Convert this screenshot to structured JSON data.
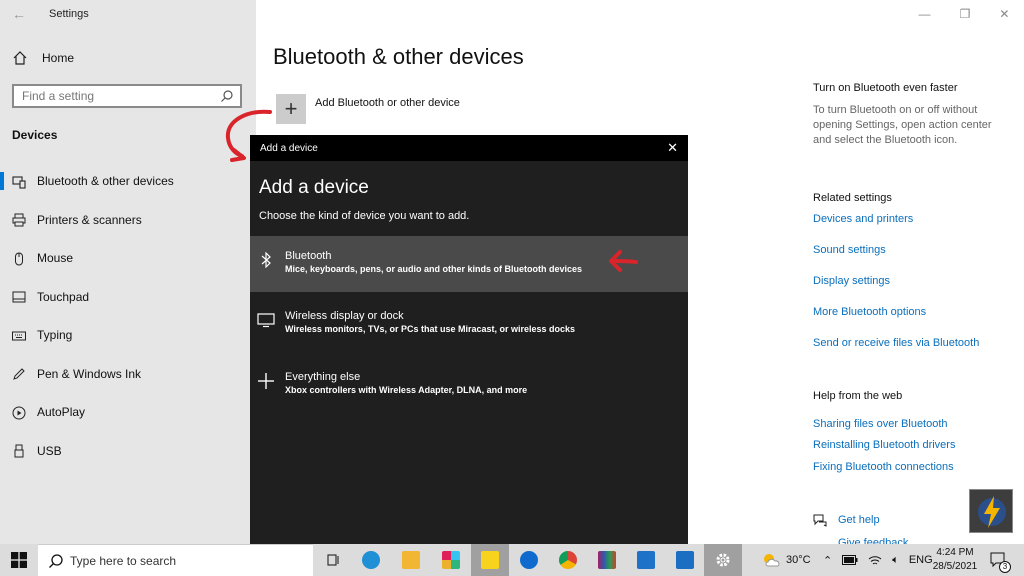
{
  "window": {
    "app_title": "Settings",
    "back_glyph": "←",
    "min_glyph": "—",
    "max_glyph": "❐",
    "close_glyph": "✕"
  },
  "sidebar": {
    "home_label": "Home",
    "search_placeholder": "Find a setting",
    "section_title": "Devices",
    "items": [
      {
        "label": "Bluetooth & other devices",
        "icon": "bluetooth-devices-icon",
        "active": true
      },
      {
        "label": "Printers & scanners",
        "icon": "printer-icon"
      },
      {
        "label": "Mouse",
        "icon": "mouse-icon"
      },
      {
        "label": "Touchpad",
        "icon": "touchpad-icon"
      },
      {
        "label": "Typing",
        "icon": "keyboard-icon"
      },
      {
        "label": "Pen & Windows Ink",
        "icon": "pen-icon"
      },
      {
        "label": "AutoPlay",
        "icon": "autoplay-icon"
      },
      {
        "label": "USB",
        "icon": "usb-icon"
      }
    ]
  },
  "main": {
    "title": "Bluetooth & other devices",
    "add_label": "Add Bluetooth or other device"
  },
  "right": {
    "faster_heading": "Turn on Bluetooth even faster",
    "faster_text": "To turn Bluetooth on or off without opening Settings, open action center and select the Bluetooth icon.",
    "related_heading": "Related settings",
    "related_links": [
      "Devices and printers",
      "Sound settings",
      "Display settings",
      "More Bluetooth options",
      "Send or receive files via Bluetooth"
    ],
    "help_heading": "Help from the web",
    "help_links": [
      "Sharing files over Bluetooth",
      "Reinstalling Bluetooth drivers",
      "Fixing Bluetooth connections"
    ],
    "get_help": "Get help",
    "give_feedback": "Give feedback"
  },
  "dialog": {
    "titlebar": "Add a device",
    "heading": "Add a device",
    "subtitle": "Choose the kind of device you want to add.",
    "options": [
      {
        "title": "Bluetooth",
        "desc": "Mice, keyboards, pens, or audio and other kinds of Bluetooth devices",
        "icon": "bluetooth-icon",
        "selected": true
      },
      {
        "title": "Wireless display or dock",
        "desc": "Wireless monitors, TVs, or PCs that use Miracast, or wireless docks",
        "icon": "monitor-icon"
      },
      {
        "title": "Everything else",
        "desc": "Xbox controllers with Wireless Adapter, DLNA, and more",
        "icon": "plus-icon"
      }
    ]
  },
  "taskbar": {
    "search_placeholder": "Type here to search",
    "weather": "30°C",
    "language": "ENG",
    "time": "4:24 PM",
    "date": "28/5/2021",
    "notification_count": "3"
  },
  "colors": {
    "accent": "#0078d7",
    "link": "#0a6fbc",
    "dialog_bg": "#1f1f1f",
    "annotation": "#d9242b"
  }
}
